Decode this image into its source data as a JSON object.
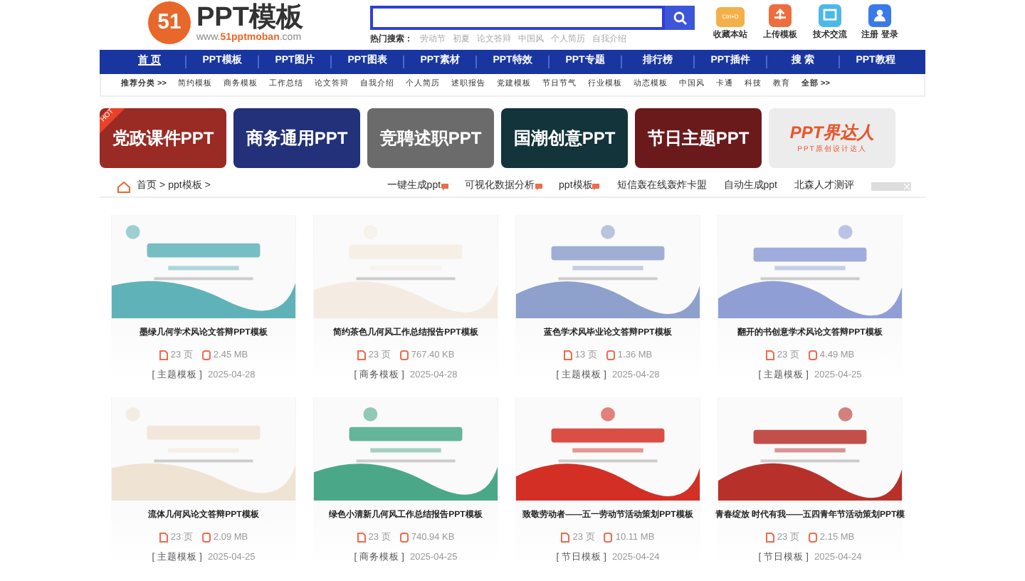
{
  "logo": {
    "mark": "51",
    "name": "PPT模板",
    "url_prefix": "www.",
    "url_brand": "51pptmoban",
    "url_suffix": ".com"
  },
  "search": {
    "hot_label": "热门搜索：",
    "hot": [
      "劳动节",
      "初夏",
      "论文答辩",
      "中国风",
      "个人简历",
      "自我介绍"
    ]
  },
  "quick_links": [
    {
      "kind": "ctrl",
      "label": "收藏本站",
      "badge": "Ctrl+D"
    },
    {
      "kind": "upload",
      "label": "上传模板"
    },
    {
      "kind": "chat",
      "label": "技术交流"
    },
    {
      "kind": "user",
      "label": "注册 登录"
    }
  ],
  "nav": [
    {
      "label": "首 页",
      "selected": true
    },
    {
      "label": "PPT模板",
      "selected": false
    },
    {
      "label": "PPT图片",
      "selected": false
    },
    {
      "label": "PPT图表",
      "selected": false
    },
    {
      "label": "PPT素材",
      "selected": false
    },
    {
      "label": "PPT特效",
      "selected": false
    },
    {
      "label": "PPT专题",
      "selected": false
    },
    {
      "label": "排行榜",
      "selected": false
    },
    {
      "label": "PPT插件",
      "selected": false
    },
    {
      "label": "搜 索",
      "selected": false
    },
    {
      "label": "PPT教程",
      "selected": false
    }
  ],
  "categories": {
    "title": "推荐分类 >>",
    "items": [
      "简约模板",
      "商务模板",
      "工作总结",
      "论文答辩",
      "自我介绍",
      "个人简历",
      "述职报告",
      "党建模板",
      "节日节气",
      "行业模板",
      "动态模板",
      "中国风",
      "卡通",
      "科技",
      "教育"
    ],
    "more": "全部 >>"
  },
  "banners": [
    {
      "title": "党政课件PPT",
      "color": "#9a2a24",
      "hot": "HOT"
    },
    {
      "title": "商务通用PPT",
      "color": "#23307a"
    },
    {
      "title": "竞聘述职PPT",
      "color": "#6b6b6b"
    },
    {
      "title": "国潮创意PPT",
      "color": "#12343a"
    },
    {
      "title": "节日主题PPT",
      "color": "#6b1a1c"
    },
    {
      "title": "PPT界达人",
      "color": "#ececec",
      "subtitle": "PPT原创设计达人"
    }
  ],
  "breadcrumb": {
    "items": [
      "首页",
      "ppt模板"
    ],
    "separator": ">"
  },
  "ads": [
    {
      "label": "一键生成ppt",
      "flag": true
    },
    {
      "label": "可视化数据分析",
      "flag": true
    },
    {
      "label": "ppt模板",
      "flag": true
    },
    {
      "label": "短信轰在线轰炸卡盟",
      "flag": false
    },
    {
      "label": "自动生成ppt",
      "flag": false
    },
    {
      "label": "北森人才测评",
      "flag": false
    }
  ],
  "cards": [
    {
      "title": "墨绿几何学术风论文答辩PPT模板",
      "pages": "23 页",
      "size": "2.45 MB",
      "type": "[ 主题模板 ]",
      "date": "2025-04-28",
      "color": "#5fb3b8"
    },
    {
      "title": "简约茶色几何风工作总结报告PPT模板",
      "pages": "23 页",
      "size": "767.40 KB",
      "type": "[ 商务模板 ]",
      "date": "2025-04-28",
      "color": "#f4ece2"
    },
    {
      "title": "蓝色学术风毕业论文答辩PPT模板",
      "pages": "13 页",
      "size": "1.36 MB",
      "type": "[ 主题模板 ]",
      "date": "2025-04-28",
      "color": "#8ea0cc"
    },
    {
      "title": "翻开的书创意学术风论文答辩PPT模板",
      "pages": "23 页",
      "size": "4.49 MB",
      "type": "[ 主题模板 ]",
      "date": "2025-04-25",
      "color": "#8f9fd6"
    },
    {
      "title": "流体几何风论文答辩PPT模板",
      "pages": "23 页",
      "size": "2.09 MB",
      "type": "[ 主题模板 ]",
      "date": "2025-04-25",
      "color": "#efe3d4"
    },
    {
      "title": "绿色小清新几何风工作总结报告PPT模板",
      "pages": "23 页",
      "size": "740.94 KB",
      "type": "[ 商务模板 ]",
      "date": "2025-04-25",
      "color": "#4aa888"
    },
    {
      "title": "致敬劳动者——五一劳动节活动策划PPT模板",
      "pages": "23 页",
      "size": "10.11 MB",
      "type": "[ 节日模板 ]",
      "date": "2025-04-24",
      "color": "#d32f25"
    },
    {
      "title": "青春绽放 时代有我——五四青年节活动策划PPT模",
      "pages": "23 页",
      "size": "2.15 MB",
      "type": "[ 节日模板 ]",
      "date": "2025-04-24",
      "color": "#b8302a"
    }
  ]
}
